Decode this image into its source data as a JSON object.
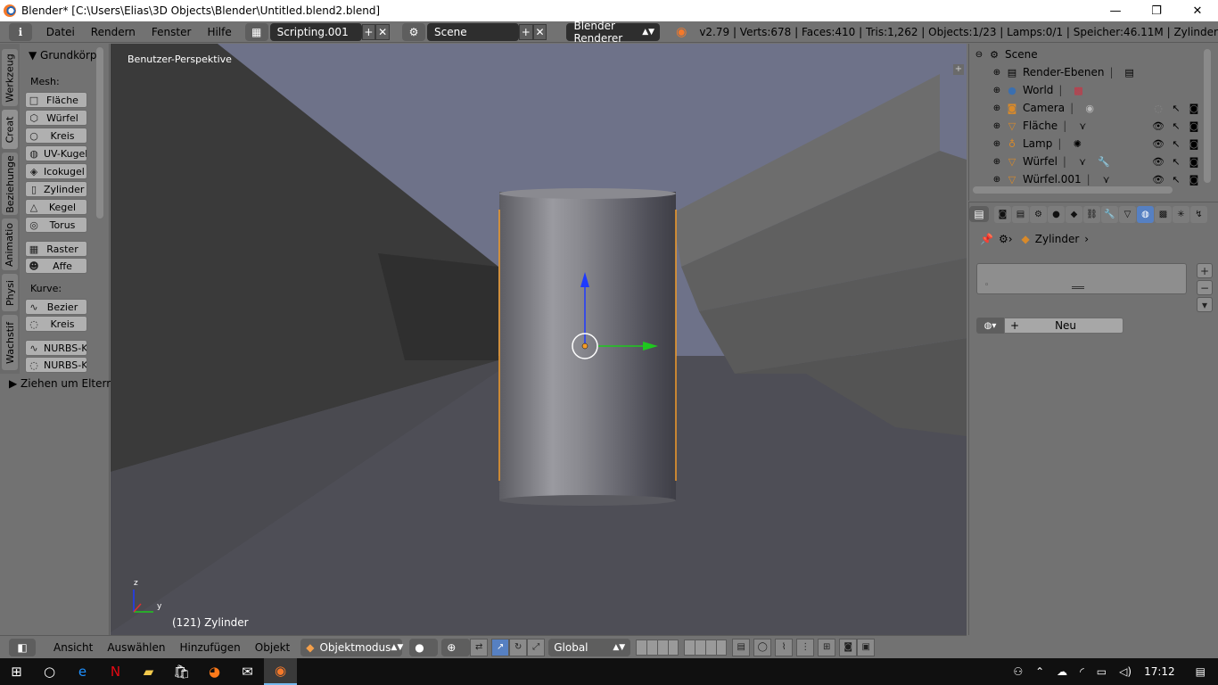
{
  "window": {
    "title": "Blender* [C:\\Users\\Elias\\3D Objects\\Blender\\Untitled.blend2.blend]",
    "minimize": "—",
    "maximize": "❐",
    "close": "✕"
  },
  "info_header": {
    "editor_icon": "ℹ",
    "menus": [
      "Datei",
      "Rendern",
      "Fenster",
      "Hilfe"
    ],
    "screen_layout": "Scripting.001",
    "scene": "Scene",
    "render_engine": "Blender Renderer",
    "stats": "v2.79 | Verts:678 | Faces:410 | Tris:1,262 | Objects:1/23 | Lamps:0/1 | Speicher:46.11M | Zylinder"
  },
  "tool_shelf": {
    "tabs": [
      "Werkzeug",
      "Creat",
      "Beziehunge",
      "Animatio",
      "Physi",
      "Wachstif"
    ],
    "panel_title": "▼ Grundkörp",
    "mesh_label": "Mesh:",
    "mesh_buttons": [
      {
        "label": "Fläche",
        "icon": "plane-icon"
      },
      {
        "label": "Würfel",
        "icon": "cube-icon"
      },
      {
        "label": "Kreis",
        "icon": "circle-icon"
      },
      {
        "label": "UV-Kugel",
        "icon": "uv-sphere-icon"
      },
      {
        "label": "Icokugel",
        "icon": "icosphere-icon"
      },
      {
        "label": "Zylinder",
        "icon": "cylinder-icon"
      },
      {
        "label": "Kegel",
        "icon": "cone-icon"
      },
      {
        "label": "Torus",
        "icon": "torus-icon"
      }
    ],
    "extra_buttons": [
      {
        "label": "Raster",
        "icon": "grid-icon"
      },
      {
        "label": "Affe",
        "icon": "monkey-icon"
      }
    ],
    "curve_label": "Kurve:",
    "curve_buttons": [
      {
        "label": "Bezier",
        "icon": "bezier-icon"
      },
      {
        "label": "Kreis",
        "icon": "curve-circle-icon"
      }
    ],
    "nurbs_buttons": [
      {
        "label": "NURBS-Ku",
        "icon": "nurbs-curve-icon"
      },
      {
        "label": "NURBS-Kr",
        "icon": "nurbs-circle-icon"
      }
    ],
    "collapsed_panel": "▶ Ziehen um Eltern"
  },
  "viewport": {
    "view_label": "Benutzer-Perspektive",
    "object_label": "(121) Zylinder",
    "axis_x": "y",
    "axis_z": "z"
  },
  "viewport_header": {
    "menus": [
      "Ansicht",
      "Auswählen",
      "Hinzufügen",
      "Objekt"
    ],
    "mode": "Objektmodus",
    "orientation": "Global"
  },
  "outliner": {
    "root": "Scene",
    "items": [
      {
        "name": "Render-Ebenen",
        "icon": "render-layers-icon"
      },
      {
        "name": "World",
        "icon": "world-icon"
      },
      {
        "name": "Camera",
        "icon": "camera-icon"
      },
      {
        "name": "Fläche",
        "icon": "mesh-icon"
      },
      {
        "name": "Lamp",
        "icon": "lamp-icon"
      },
      {
        "name": "Würfel",
        "icon": "mesh-icon"
      },
      {
        "name": "Würfel.001",
        "icon": "mesh-icon"
      }
    ]
  },
  "properties": {
    "breadcrumb_object": "Zylinder",
    "new_button": "Neu"
  },
  "taskbar": {
    "time": "17:12"
  },
  "colors": {
    "selection_outline": "#f39c2a",
    "active_tab": "#5680c2",
    "transform_z": "#1e3aff",
    "transform_y": "#1ec81e"
  }
}
